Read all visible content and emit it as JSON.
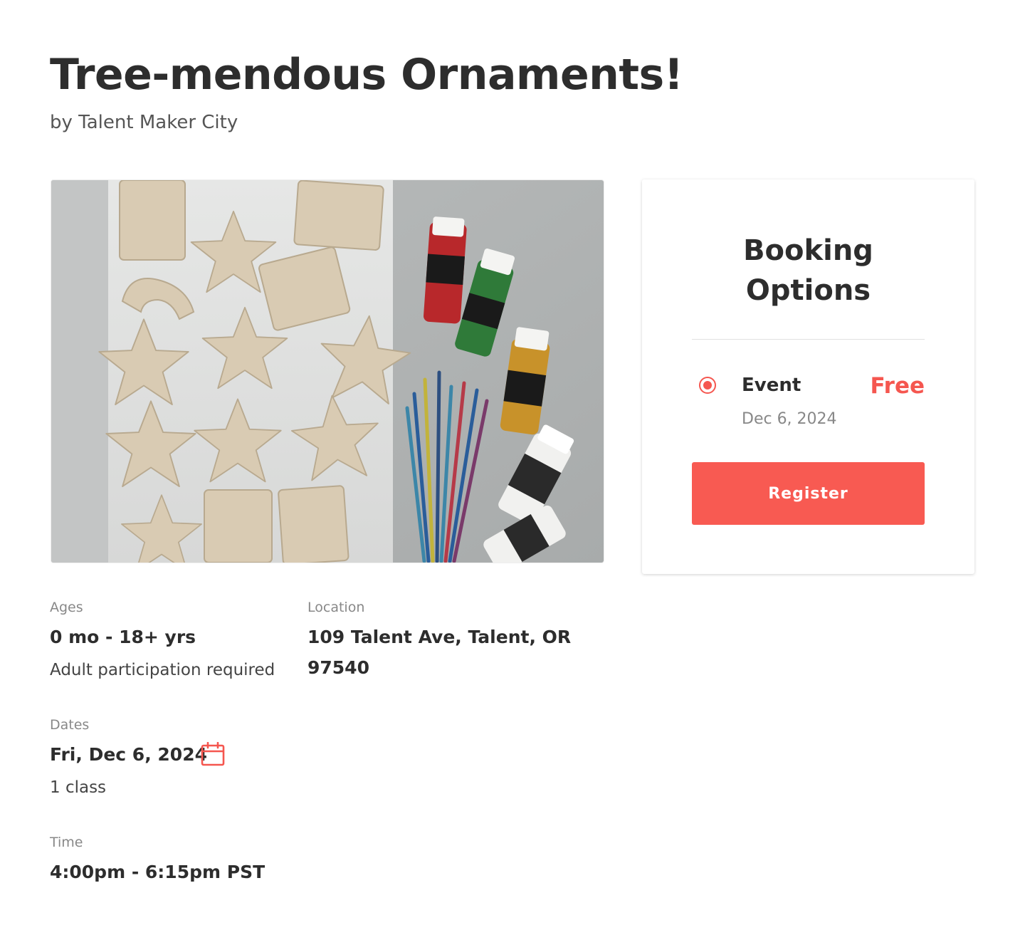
{
  "event": {
    "title": "Tree-mendous Ornaments!",
    "byline": "by Talent Maker City"
  },
  "hero_image": {
    "description": "clay-ornaments-and-paint-photo"
  },
  "details": {
    "ages": {
      "label": "Ages",
      "value": "0 mo - 18+ yrs",
      "note": "Adult participation required"
    },
    "location": {
      "label": "Location",
      "line1": "109 Talent Ave, Talent, OR",
      "line2": "97540"
    },
    "dates": {
      "label": "Dates",
      "value": "Fri, Dec 6, 2024",
      "count": "1 class",
      "icon": "calendar-icon"
    },
    "time": {
      "label": "Time",
      "value": "4:00pm - 6:15pm PST"
    }
  },
  "booking": {
    "title_line1": "Booking",
    "title_line2": "Options",
    "option": {
      "name": "Event",
      "price": "Free",
      "date": "Dec 6, 2024",
      "selected": true
    },
    "register_label": "Register"
  },
  "colors": {
    "accent": "#f5564f",
    "text": "#2d2d2d",
    "muted": "#888888"
  }
}
